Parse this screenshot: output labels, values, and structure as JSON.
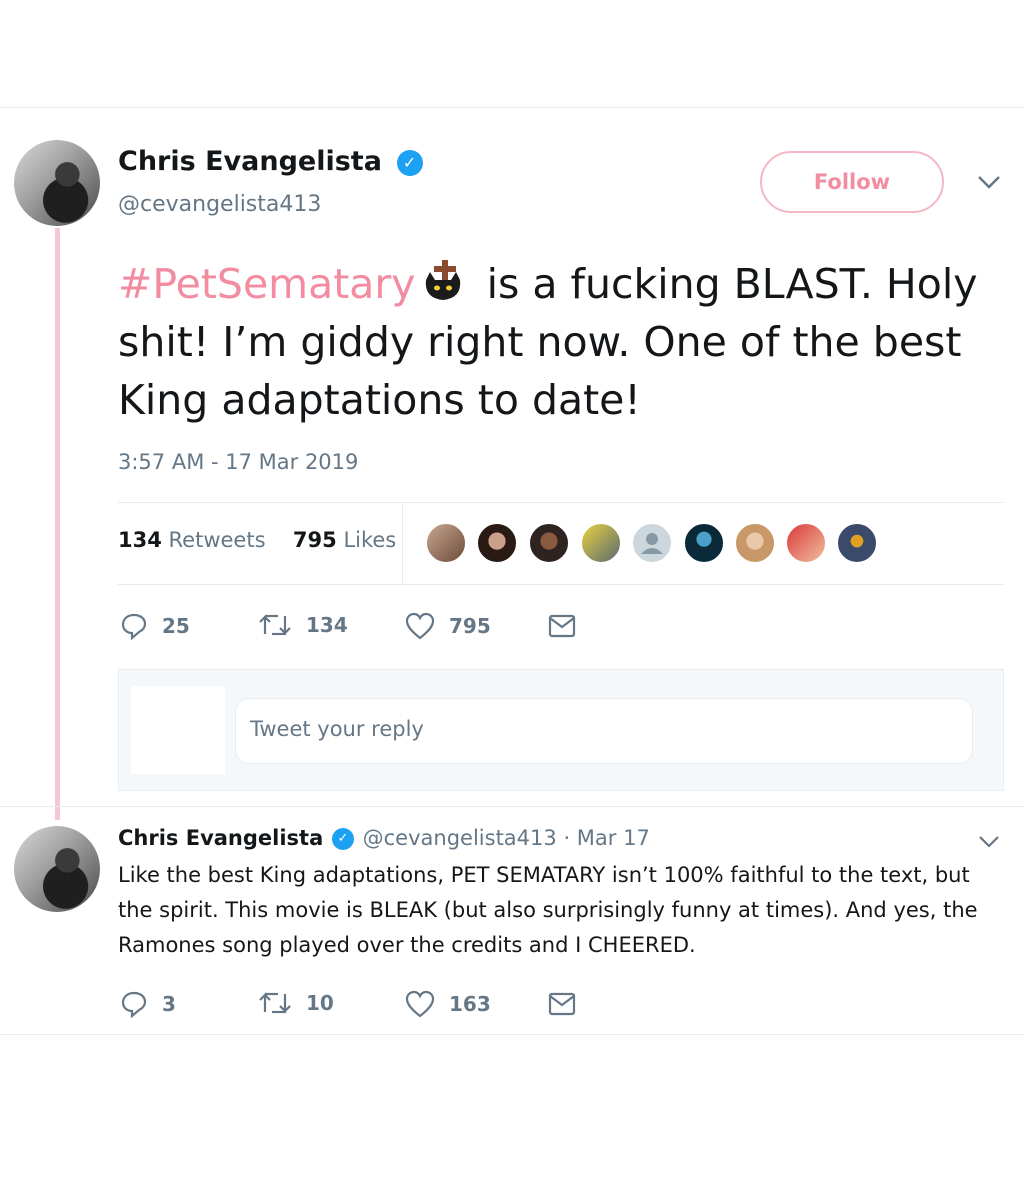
{
  "tweet": {
    "author_name": "Chris Evangelista",
    "handle": "@cevangelista413",
    "follow_label": "Follow",
    "hashtag": "#PetSematary",
    "text_after_emoji": " is a fucking BLAST. Holy shit! I’m giddy right now. One of the best King adaptations to date!",
    "timestamp": "3:57 AM - 17 Mar 2019",
    "retweets_count": "134",
    "retweets_label": "Retweets",
    "likes_count": "795",
    "likes_label": "Likes",
    "actions": {
      "replies": "25",
      "retweets": "134",
      "likes": "795"
    },
    "hashtag_color": "#f28ca0"
  },
  "reply_box": {
    "placeholder": "Tweet your reply"
  },
  "reply_tweet": {
    "author_name": "Chris Evangelista",
    "handle": "@cevangelista413",
    "date": "· Mar 17",
    "text": "Like the best King adaptations, PET SEMATARY isn’t 100% faithful to the text, but the spirit. This movie is BLEAK (but also surprisingly funny at times). And yes, the Ramones song played over the credits and I CHEERED.",
    "actions": {
      "replies": "3",
      "retweets": "10",
      "likes": "163"
    }
  },
  "icons": [
    "verified-badge-icon",
    "chevron-down-icon",
    "reply-icon",
    "retweet-icon",
    "heart-icon",
    "direct-message-icon",
    "black-cat-emoji",
    "cross-emoji"
  ],
  "colors": {
    "accent_pink": "#f28ca0",
    "verified_blue": "#1da1f2",
    "muted": "#657786",
    "thread_line": "#f5c9d3"
  }
}
